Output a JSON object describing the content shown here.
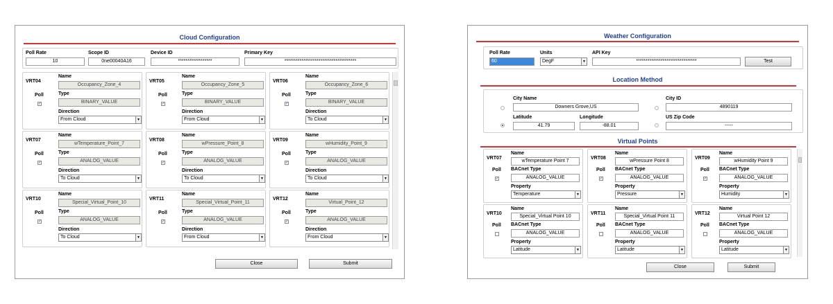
{
  "cloud": {
    "title": "Cloud Configuration",
    "poll_rate_label": "Poll Rate",
    "poll_rate": "10",
    "scope_id_label": "Scope ID",
    "scope_id": "0ne00040A16",
    "device_id_label": "Device ID",
    "device_id": "******************",
    "primary_key_label": "Primary Key",
    "primary_key": "**************************************",
    "name_label": "Name",
    "poll_label": "Poll",
    "type_label": "Type",
    "direction_label": "Direction",
    "cards": [
      {
        "vrt": "VRT04",
        "name": "Occupancy_Zone_4",
        "type": "BINARY_VALUE",
        "direction": "From Cloud",
        "poll": true
      },
      {
        "vrt": "VRT05",
        "name": "Occupancy_Zone_5",
        "type": "BINARY_VALUE",
        "direction": "From Cloud",
        "poll": true
      },
      {
        "vrt": "VRT06",
        "name": "Occupancy_Zone_6",
        "type": "BINARY_VALUE",
        "direction": "To Cloud",
        "poll": true
      },
      {
        "vrt": "VRT07",
        "name": "wTemperature_Point_7",
        "type": "ANALOG_VALUE",
        "direction": "To Cloud",
        "poll": true
      },
      {
        "vrt": "VRT08",
        "name": "wPressure_Point_8",
        "type": "ANALOG_VALUE",
        "direction": "To Cloud",
        "poll": true
      },
      {
        "vrt": "VRT09",
        "name": "wHumidity_Point_9",
        "type": "ANALOG_VALUE",
        "direction": "To Cloud",
        "poll": true
      },
      {
        "vrt": "VRT10",
        "name": "Special_Virtual_Point_10",
        "type": "ANALOG_VALUE",
        "direction": "To Cloud",
        "poll": true
      },
      {
        "vrt": "VRT11",
        "name": "Special_Virtual_Point_11",
        "type": "ANALOG_VALUE",
        "direction": "From Cloud",
        "poll": true
      },
      {
        "vrt": "VRT12",
        "name": "Virtual_Point_12",
        "type": "ANALOG_VALUE",
        "direction": "From Cloud",
        "poll": true
      }
    ],
    "close_label": "Close",
    "submit_label": "Submit"
  },
  "weather": {
    "title": "Weather Configuration",
    "poll_rate_label": "Poll Rate",
    "poll_rate": "60",
    "units_label": "Units",
    "units": "DegF",
    "api_key_label": "API Key",
    "api_key": "********************************",
    "test_label": "Test",
    "location_title": "Location Method",
    "city_name_label": "City Name",
    "city_name": "Downers Grove,US",
    "city_id_label": "City ID",
    "city_id": "4890119",
    "latitude_label": "Latitude",
    "latitude": "41.79",
    "longitude_label": "Longitude",
    "longitude": "-88.01",
    "zip_label": "US Zip Code",
    "zip": "-----",
    "virtual_title": "Virtual Points",
    "name_label": "Name",
    "poll_label": "Poll",
    "bacnet_type_label": "BACnet Type",
    "property_label": "Property",
    "cards": [
      {
        "vrt": "VRT07",
        "name": "wTemperature Point 7",
        "type": "ANALOG_VALUE",
        "property": "Temperature",
        "poll": true
      },
      {
        "vrt": "VRT08",
        "name": "wPressure Point 8",
        "type": "ANALOG_VALUE",
        "property": "Pressure",
        "poll": true
      },
      {
        "vrt": "VRT09",
        "name": "wHumidity Point 9",
        "type": "ANALOG_VALUE",
        "property": "Humidity",
        "poll": true
      },
      {
        "vrt": "VRT10",
        "name": "Special_Virtual Point 10",
        "type": "ANALOG_VALUE",
        "property": "Latitude",
        "poll": false
      },
      {
        "vrt": "VRT11",
        "name": "Special_Virtual Point 11",
        "type": "ANALOG_VALUE",
        "property": "Latitude",
        "poll": false
      },
      {
        "vrt": "VRT12",
        "name": "Virtual Point 12",
        "type": "ANALOG_VALUE",
        "property": "Latitude",
        "poll": false
      }
    ],
    "close_label": "Close",
    "submit_label": "Submit"
  }
}
